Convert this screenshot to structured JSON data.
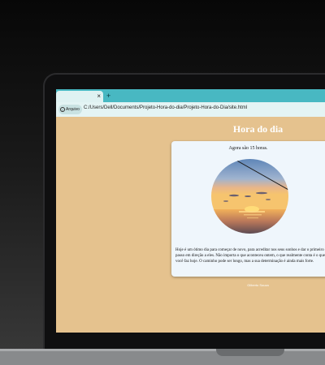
{
  "browser": {
    "tab": {
      "close_glyph": "×"
    },
    "new_tab_glyph": "+",
    "address_bar": {
      "security_label": "Arquivo",
      "url": "C:/Users/Dell/Documents/Projeto-Hora-do-dia/Projeto-Hora-do-Dia/site.html"
    }
  },
  "page": {
    "title": "Hora do dia",
    "time_message": "Agora são 15 horas.",
    "image_subject": "sunset over the sea",
    "body_text": "Hoje é um ótimo dia para começar de novo, para acreditar nos seus sonhos e dar o primeiro passo em direção a eles. Não importa o que aconteceu ontem, o que realmente conta é o que você faz hoje. O caminho pode ser longo, mas a sua determinação é ainda mais forte.",
    "footer": "Gilberto Souza"
  },
  "colors": {
    "page_background": "#e5c28e",
    "card_background": "#eff6fc",
    "tab_strip": "#48b8c2"
  }
}
